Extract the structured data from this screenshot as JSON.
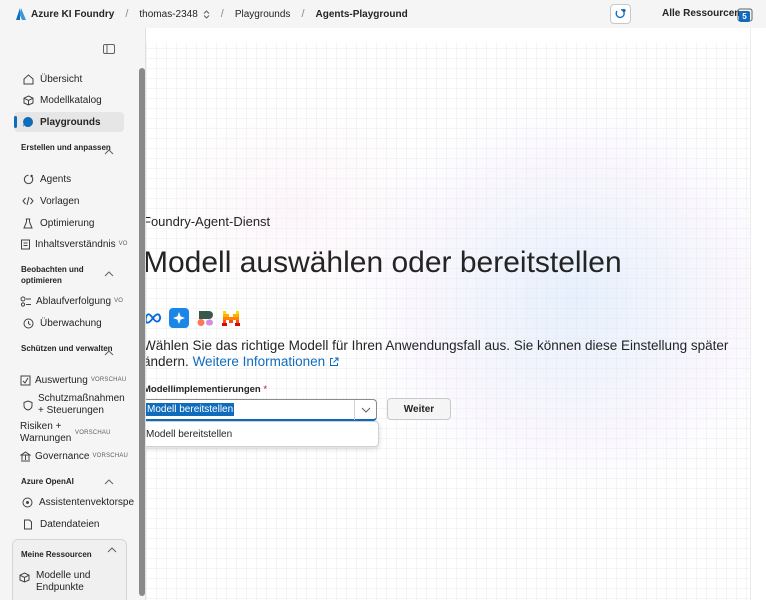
{
  "topbar": {
    "brand": "Azure KI Foundry",
    "breadcrumbs": [
      "thomas-2348",
      "Playgrounds",
      "Agents-Playground"
    ],
    "all_resources": "Alle Ressourcen",
    "notification_count": "5"
  },
  "sidebar": {
    "items": [
      {
        "label": "Übersicht",
        "icon": "home-icon"
      },
      {
        "label": "Modellkatalog",
        "icon": "cube-icon"
      },
      {
        "label": "Playgrounds",
        "icon": "chat-icon",
        "active": true
      }
    ],
    "sections": [
      {
        "title": "Erstellen und anpassen",
        "items": [
          {
            "label": "Agents",
            "icon": "agent-icon"
          },
          {
            "label": "Vorlagen",
            "icon": "code-icon"
          },
          {
            "label": "Optimierung",
            "icon": "flask-icon"
          },
          {
            "label": "Inhaltsverständnis",
            "badge": "VO",
            "icon": "document-icon"
          }
        ]
      },
      {
        "title": "Beobachten und optimieren",
        "items": [
          {
            "label": "Ablaufverfolgung",
            "badge": "VO",
            "icon": "trace-icon"
          },
          {
            "label": "Überwachung",
            "icon": "monitor-icon"
          }
        ]
      },
      {
        "title": "Schützen und verwalten",
        "items": [
          {
            "label": "Auswertung",
            "badge": "VORSCHAU",
            "icon": "evaluation-icon"
          },
          {
            "label": "Schutzmaßnahmen + Steuerungen",
            "icon": "shield-icon"
          },
          {
            "label": "Risiken + Warnungen",
            "badge": "VORSCHAU",
            "icon": "warning-icon"
          },
          {
            "label": "Governance",
            "badge": "VORSCHAU",
            "icon": "governance-icon"
          }
        ]
      },
      {
        "title": "Azure OpenAI",
        "items": [
          {
            "label": "Assistentenvektorspe",
            "icon": "vector-icon"
          },
          {
            "label": "Datendateien",
            "icon": "file-icon"
          }
        ]
      }
    ],
    "my_resources": {
      "title": "Meine Ressourcen",
      "item": "Modelle und Endpunkte"
    }
  },
  "main": {
    "service_name": "Foundry-Agent-Dienst",
    "title": "Modell auswählen oder bereitstellen",
    "providers": [
      "meta-icon",
      "azure-spark-icon",
      "cohere-icon",
      "mistral-icon"
    ],
    "description": "Wählen Sie das richtige Modell für Ihren Anwendungsfall aus. Sie können diese Einstellung später ändern.",
    "more_info_link": "Weitere Informationen",
    "field_label": "Modellimplementierungen",
    "required_mark": "*",
    "select_value": "Modell bereitstellen",
    "next_button": "Weiter",
    "dropdown_options": [
      "Modell bereitstellen"
    ]
  },
  "colors": {
    "accent": "#0f6cbd",
    "required": "#c50f1f"
  }
}
